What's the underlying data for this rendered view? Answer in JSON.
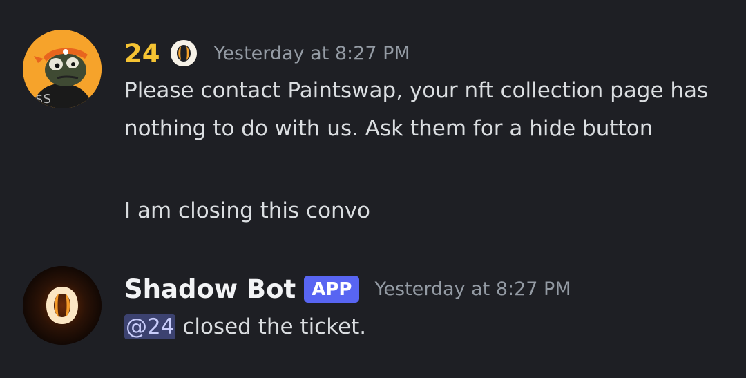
{
  "messages": [
    {
      "username": "24",
      "timestamp": "Yesterday at 8:27 PM",
      "paragraphs": [
        "Please contact Paintswap, your nft collection page has nothing to do with us. Ask them for a hide button",
        "I am closing this convo"
      ],
      "avatar_icon": "frog-avatar-icon",
      "role_icon": "shadow-logo-icon",
      "username_color": "#f5c333"
    },
    {
      "username": "Shadow Bot",
      "badge": "APP",
      "timestamp": "Yesterday at 8:27 PM",
      "mention": "@24",
      "text": " closed the ticket.",
      "avatar_icon": "shadow-logo-avatar-icon",
      "badge_color": "#5865f2"
    }
  ],
  "colors": {
    "background": "#1e1f24",
    "text": "#dbdee1",
    "timestamp": "#949ba4",
    "accent_orange": "#f6a32b"
  }
}
